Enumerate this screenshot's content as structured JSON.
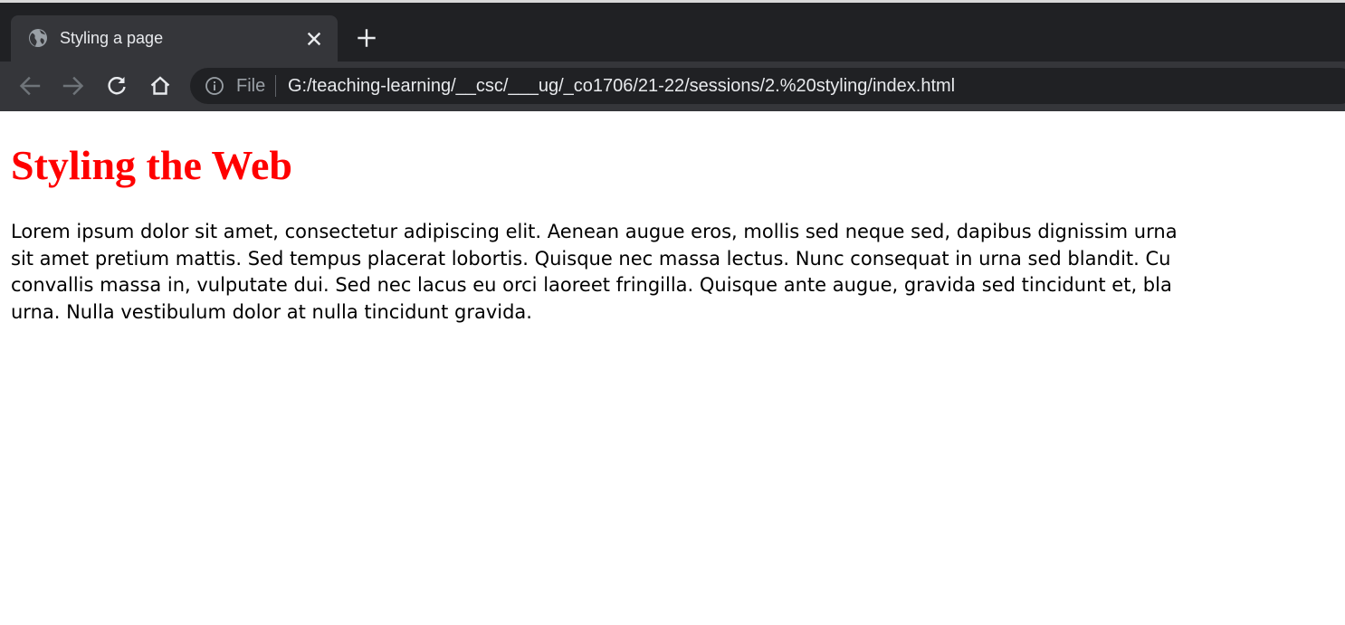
{
  "browser": {
    "tab": {
      "title": "Styling a page",
      "favicon": "globe-icon"
    },
    "toolbar": {
      "back": "arrow-left-icon",
      "forward": "arrow-right-icon",
      "reload": "reload-icon",
      "home": "home-icon"
    },
    "omnibox": {
      "scheme_label": "File",
      "url": "G:/teaching-learning/__csc/___ug/_co1706/21-22/sessions/2.%20styling/index.html"
    }
  },
  "page": {
    "heading": "Styling the Web",
    "paragraph_lines": [
      "Lorem ipsum dolor sit amet, consectetur adipiscing elit. Aenean augue eros, mollis sed neque sed, dapibus dignissim urna",
      "sit amet pretium mattis. Sed tempus placerat lobortis. Quisque nec massa lectus. Nunc consequat in urna sed blandit. Cu",
      "convallis massa in, vulputate dui. Sed nec lacus eu orci laoreet fringilla. Quisque ante augue, gravida sed tincidunt et, bla",
      "urna. Nulla vestibulum dolor at nulla tincidunt gravida."
    ]
  },
  "colors": {
    "tabbar_bg": "#202124",
    "toolbar_bg": "#35363a",
    "heading": "#ff0000",
    "text": "#000000"
  }
}
